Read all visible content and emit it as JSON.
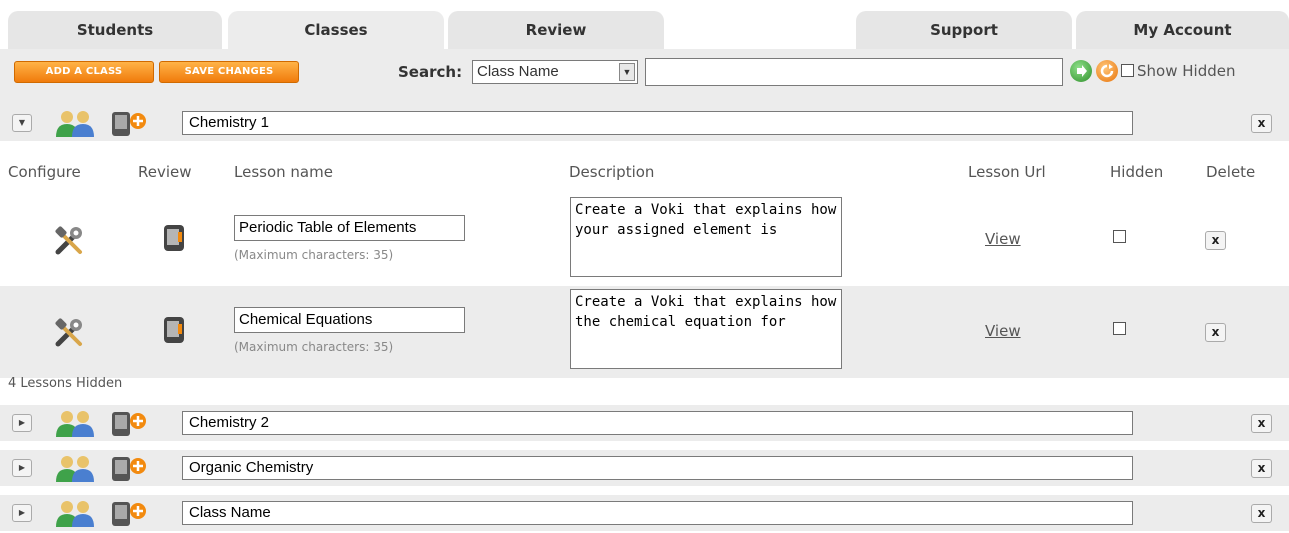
{
  "tabs": [
    {
      "label": "Students"
    },
    {
      "label": "Classes",
      "active": true
    },
    {
      "label": "Review"
    },
    {
      "label": "Support"
    },
    {
      "label": "My Account"
    }
  ],
  "toolbar": {
    "add_class_label": "ADD A CLASS",
    "save_changes_label": "SAVE CHANGES",
    "search_label": "Search:",
    "search_field_selected": "Class Name",
    "search_value": "",
    "show_hidden_label": "Show Hidden",
    "show_hidden_checked": false
  },
  "classes": [
    {
      "name": "Chemistry 1",
      "expanded": true
    },
    {
      "name": "Chemistry 2",
      "expanded": false
    },
    {
      "name": "Organic Chemistry",
      "expanded": false
    },
    {
      "name": "Class Name",
      "expanded": false
    }
  ],
  "lessons_table": {
    "headers": {
      "configure": "Configure",
      "review": "Review",
      "lesson_name": "Lesson name",
      "description": "Description",
      "lesson_url": "Lesson Url",
      "hidden": "Hidden",
      "delete": "Delete"
    },
    "rows": [
      {
        "lesson_name": "Periodic Table of Elements",
        "max_chars_note": "(Maximum characters: 35)",
        "description": "Create a Voki that explains how your assigned element is",
        "url_label": "View",
        "hidden": false
      },
      {
        "lesson_name": "Chemical Equations",
        "max_chars_note": "(Maximum characters: 35)",
        "description": "Create a Voki that explains how the chemical equation for",
        "url_label": "View",
        "hidden": false
      }
    ],
    "hidden_count_label": "4 Lessons Hidden"
  },
  "colors": {
    "accent_orange": "#f07b0b",
    "panel_gray": "#ececec"
  }
}
